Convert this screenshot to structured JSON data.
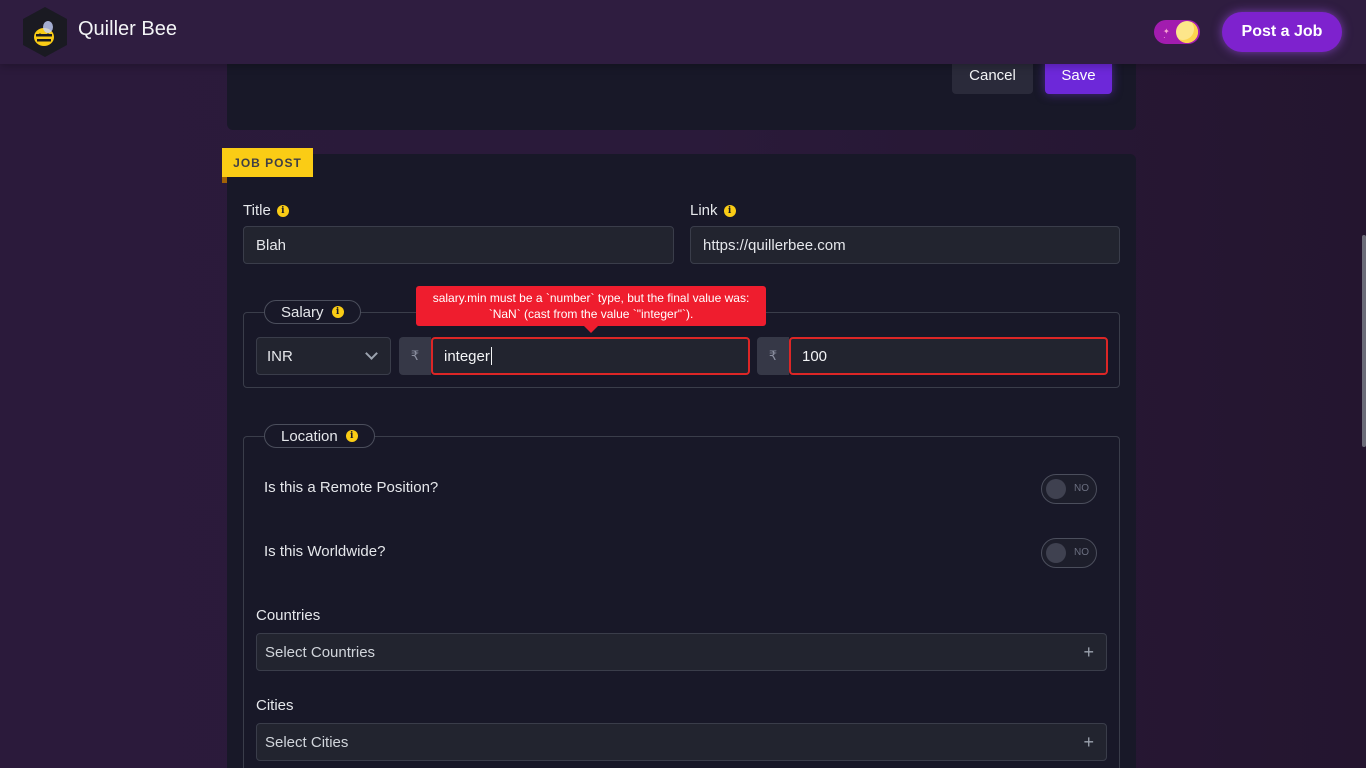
{
  "header": {
    "brand": "Quiller Bee",
    "post_job_label": "Post a Job",
    "theme_toggle_icon": "moon-sun-toggle-icon",
    "logo_icon": "bee-logo-icon"
  },
  "top_form": {
    "cancel_label": "Cancel",
    "save_label": "Save"
  },
  "job_post": {
    "badge": "JOB POST",
    "title_label": "Title",
    "title_value": "Blah",
    "link_label": "Link",
    "link_value": "https://quillerbee.com",
    "salary": {
      "label": "Salary",
      "currency": "INR",
      "currency_symbol": "₹",
      "min_value": "integer",
      "max_value": "100",
      "error": "salary.min must be a `number` type, but the final value was: `NaN` (cast from the value `\"integer\"`)."
    },
    "location": {
      "label": "Location",
      "remote_question": "Is this a Remote Position?",
      "remote_state": "NO",
      "worldwide_question": "Is this Worldwide?",
      "worldwide_state": "NO",
      "countries_label": "Countries",
      "countries_placeholder": "Select Countries",
      "cities_label": "Cities",
      "cities_placeholder": "Select Cities"
    }
  },
  "colors": {
    "accent": "#7e22ce",
    "badge": "#facc15",
    "error": "#ef1d2e",
    "card": "#181828",
    "page_bg": "#2a1a3a"
  }
}
